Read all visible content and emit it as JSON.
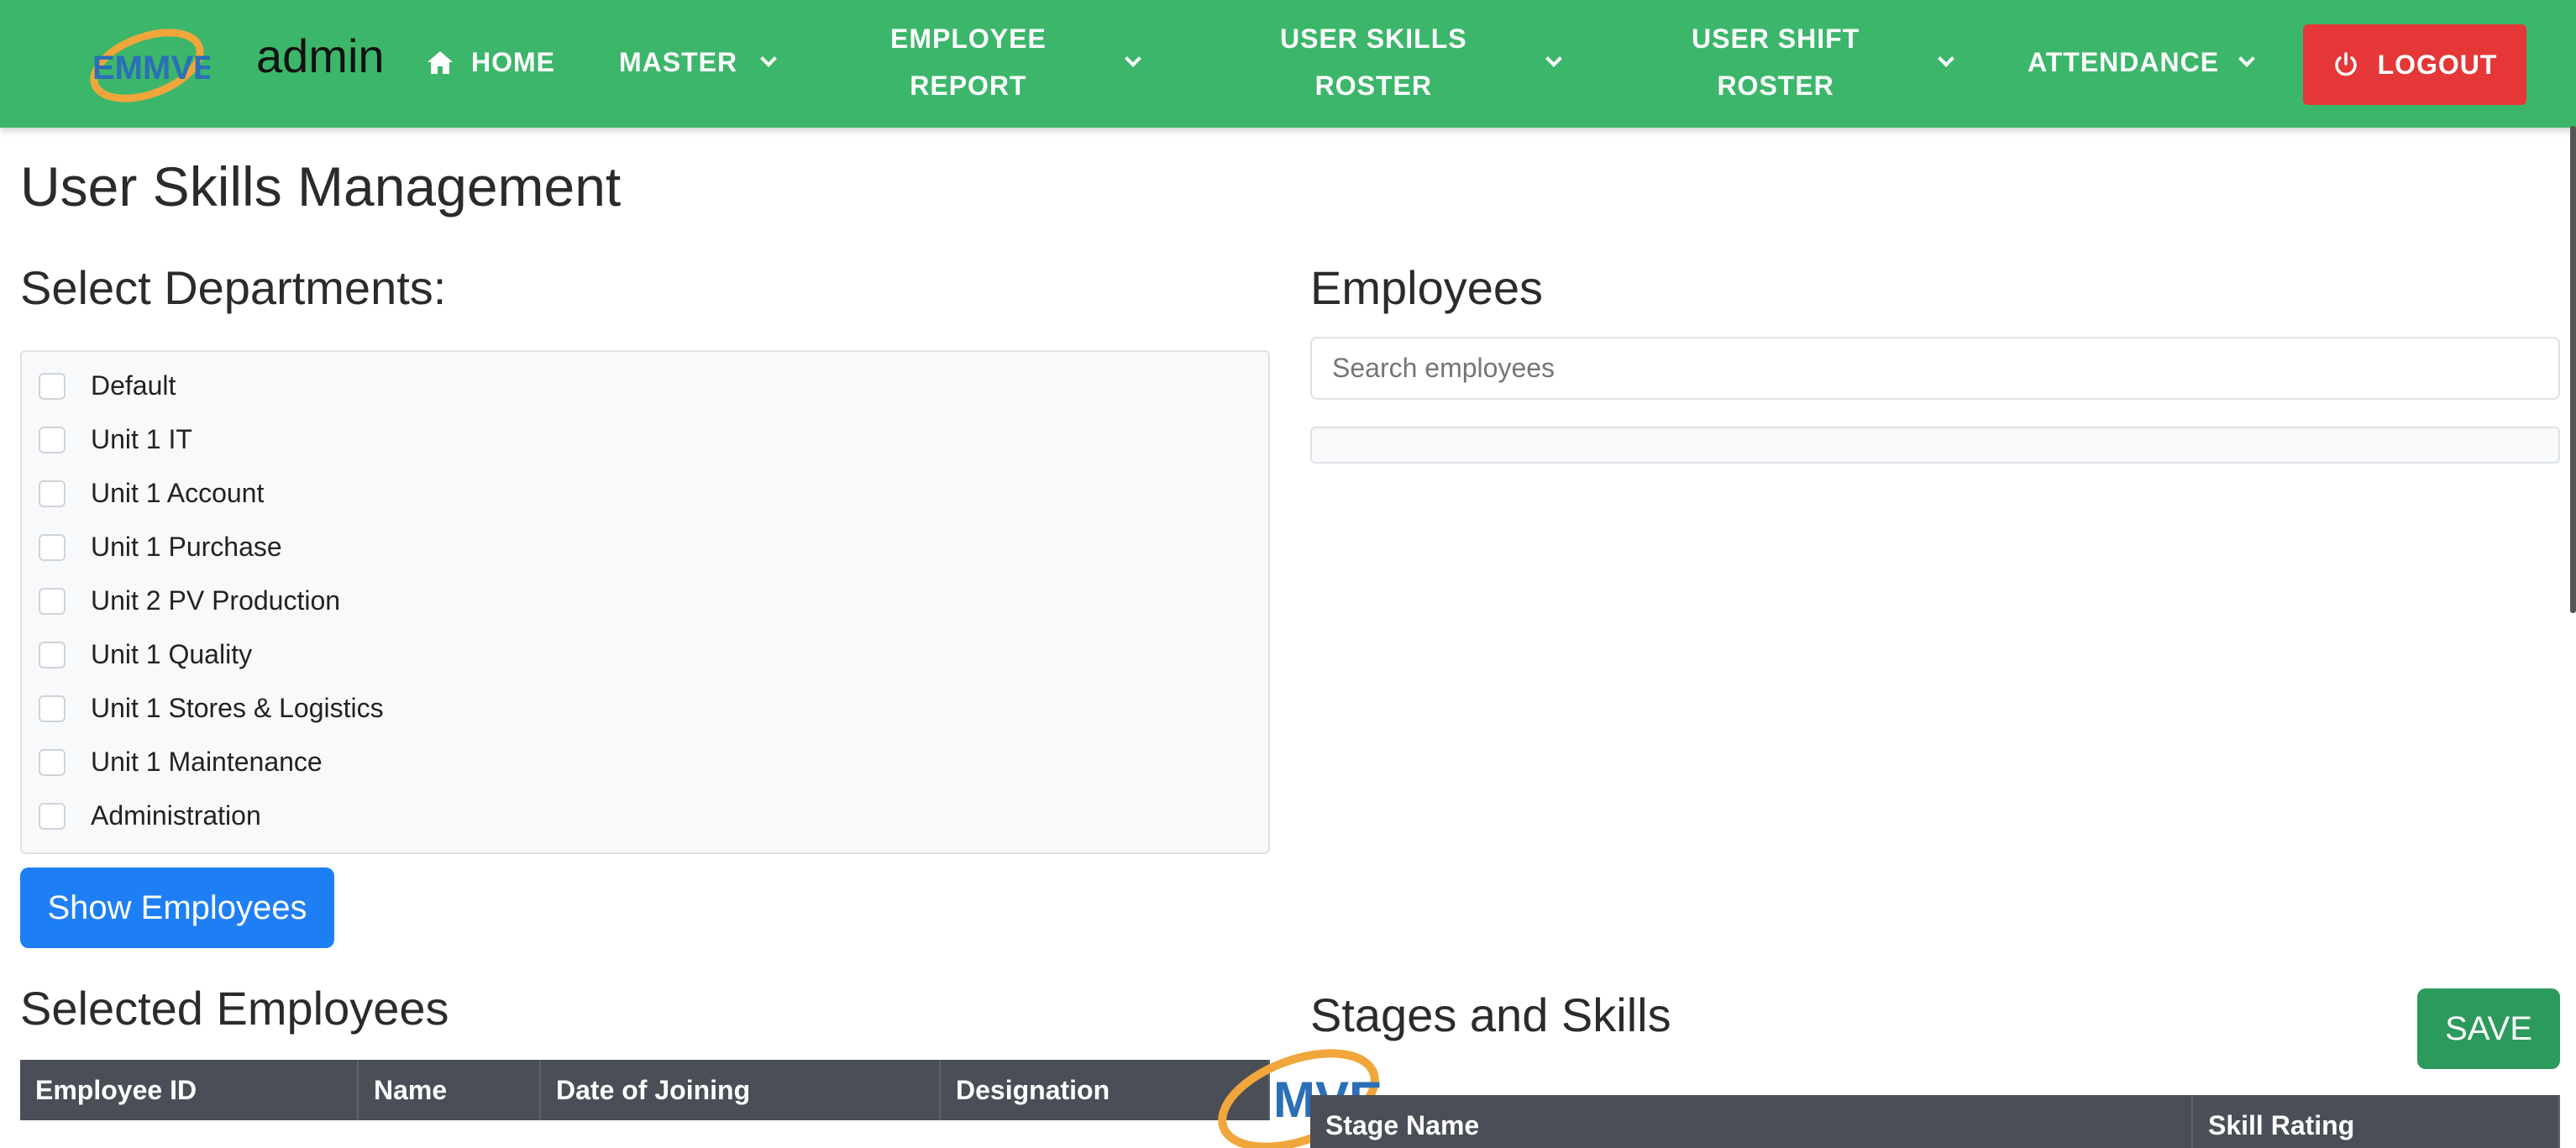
{
  "navbar": {
    "brand": "admin",
    "logo_text": "EMMVEE",
    "colors": {
      "bg": "#3cb66a",
      "logout": "#e53737"
    },
    "items": [
      {
        "label": "HOME",
        "icon": "home-icon"
      },
      {
        "label": "MASTER",
        "icon": "chevron-down-icon"
      },
      {
        "label_line1": "EMPLOYEE",
        "label_line2": "REPORT",
        "icon": "chevron-down-icon"
      },
      {
        "label_line1": "USER SKILLS",
        "label_line2": "ROSTER",
        "icon": "chevron-down-icon"
      },
      {
        "label_line1": "USER SHIFT",
        "label_line2": "ROSTER",
        "icon": "chevron-down-icon"
      },
      {
        "label": "ATTENDANCE",
        "icon": "chevron-down-icon"
      }
    ],
    "logout_label": "LOGOUT"
  },
  "page": {
    "title": "User Skills Management",
    "departments_heading": "Select Departments:",
    "departments": [
      "Default",
      "Unit 1 IT",
      "Unit 1 Account",
      "Unit 1 Purchase",
      "Unit 2 PV Production",
      "Unit 1 Quality",
      "Unit 1 Stores & Logistics",
      "Unit 1 Maintenance",
      "Administration"
    ],
    "show_button": "Show Employees",
    "employees_heading": "Employees",
    "search_placeholder": "Search employees",
    "selected_heading": "Selected Employees",
    "selected_columns": [
      "Employee ID",
      "Name",
      "Date of Joining",
      "Designation"
    ],
    "stages_heading": "Stages and Skills",
    "save_button": "SAVE",
    "stage_columns": [
      "Stage Name",
      "Skill Rating"
    ]
  }
}
